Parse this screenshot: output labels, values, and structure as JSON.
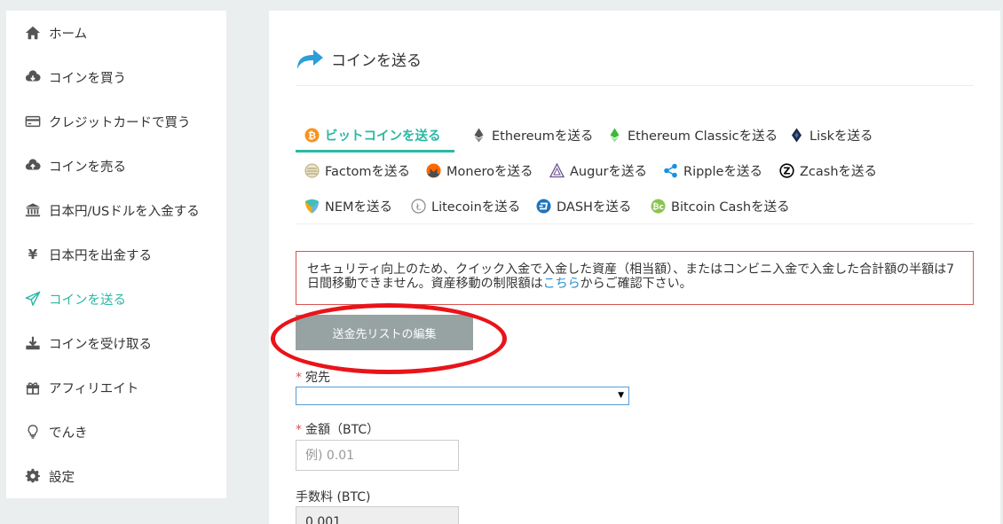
{
  "sidebar": {
    "items": [
      {
        "label": "ホーム",
        "icon": "home-icon"
      },
      {
        "label": "コインを買う",
        "icon": "cloud-download-icon"
      },
      {
        "label": "クレジットカードで買う",
        "icon": "credit-card-icon"
      },
      {
        "label": "コインを売る",
        "icon": "cloud-upload-icon"
      },
      {
        "label": "日本円/USドルを入金する",
        "icon": "bank-icon"
      },
      {
        "label": "日本円を出金する",
        "icon": "yen-icon"
      },
      {
        "label": "コインを送る",
        "icon": "paper-plane-icon",
        "active": true
      },
      {
        "label": "コインを受け取る",
        "icon": "download-tray-icon"
      },
      {
        "label": "アフィリエイト",
        "icon": "gift-icon"
      },
      {
        "label": "でんき",
        "icon": "lightbulb-icon"
      },
      {
        "label": "設定",
        "icon": "gear-icon"
      }
    ],
    "accent_color": "#2bb8a4"
  },
  "main": {
    "title": "コインを送る",
    "tabs": [
      {
        "label": "ビットコインを送る",
        "icon": "bitcoin-icon",
        "active": true
      },
      {
        "label": "Ethereumを送る",
        "icon": "ethereum-icon"
      },
      {
        "label": "Ethereum Classicを送る",
        "icon": "ethereum-classic-icon"
      },
      {
        "label": "Liskを送る",
        "icon": "lisk-icon"
      },
      {
        "label": "Factomを送る",
        "icon": "factom-icon"
      },
      {
        "label": "Moneroを送る",
        "icon": "monero-icon"
      },
      {
        "label": "Augurを送る",
        "icon": "augur-icon"
      },
      {
        "label": "Rippleを送る",
        "icon": "ripple-icon"
      },
      {
        "label": "Zcashを送る",
        "icon": "zcash-icon"
      },
      {
        "label": "NEMを送る",
        "icon": "nem-icon"
      },
      {
        "label": "Litecoinを送る",
        "icon": "litecoin-icon"
      },
      {
        "label": "DASHを送る",
        "icon": "dash-icon"
      },
      {
        "label": "Bitcoin Cashを送る",
        "icon": "bitcoin-cash-icon"
      }
    ],
    "alert": {
      "text_before": "セキュリティ向上のため、クイック入金で入金した資産（相当額）、またはコンビニ入金で入金した合計額の半額は7日間移動できません。資産移動の制限額は",
      "link": "こちら",
      "text_after": "からご確認下さい。",
      "border_color": "#d9534f"
    },
    "edit_button": "送金先リストの編集",
    "form": {
      "destination_label": "宛先",
      "destination_value": "",
      "amount_label": "金額（BTC）",
      "amount_placeholder": "例) 0.01",
      "fee_label": "手数料 (BTC)",
      "fee_value": "0.001",
      "required_mark": "*"
    }
  }
}
